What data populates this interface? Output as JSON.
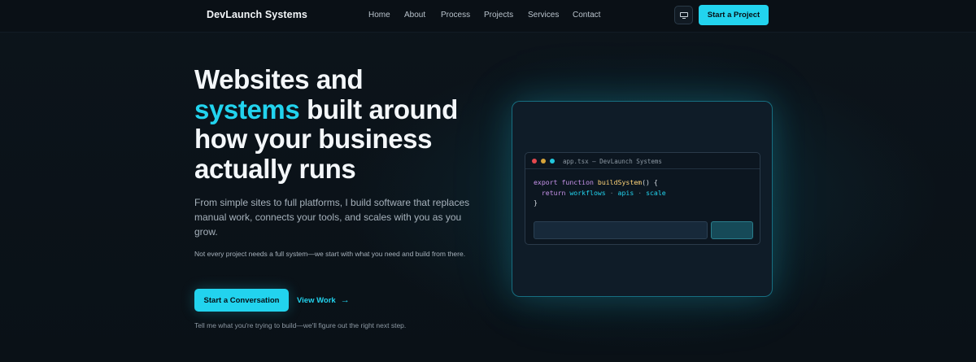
{
  "brand": "DevLaunch Systems",
  "nav": {
    "links": [
      "Home",
      "About",
      "Process",
      "Projects",
      "Services",
      "Contact"
    ],
    "theme_icon": "monitor-icon",
    "cta_label": "Start a Project"
  },
  "hero": {
    "title_line1": "Websites and",
    "title_accent": "systems",
    "title_rest": " built around how your business actually runs",
    "lead": "From simple sites to full platforms, I build software that replaces manual work, connects your tools, and scales with you as you grow.",
    "note": "Not every project needs a full system—we start with what you need and build from there.",
    "primary_cta": "Start a Conversation",
    "secondary_cta": "View Work",
    "secondary_arrow": "→",
    "footnote": "Tell me what you're trying to build—we'll figure out the right next step."
  },
  "code_window": {
    "title": "app.tsx — DevLaunch Systems",
    "line1_kw": "export function",
    "line1_fn": "buildSystem",
    "line1_rest": "() {",
    "line2_kw": "return",
    "line2_a": "workflows",
    "line2_sep1": " · ",
    "line2_b": "apis",
    "line2_sep2": " · ",
    "line2_c": "scale",
    "line3": "}"
  },
  "colors": {
    "accent": "#22d3ee",
    "background": "#0b1219"
  }
}
